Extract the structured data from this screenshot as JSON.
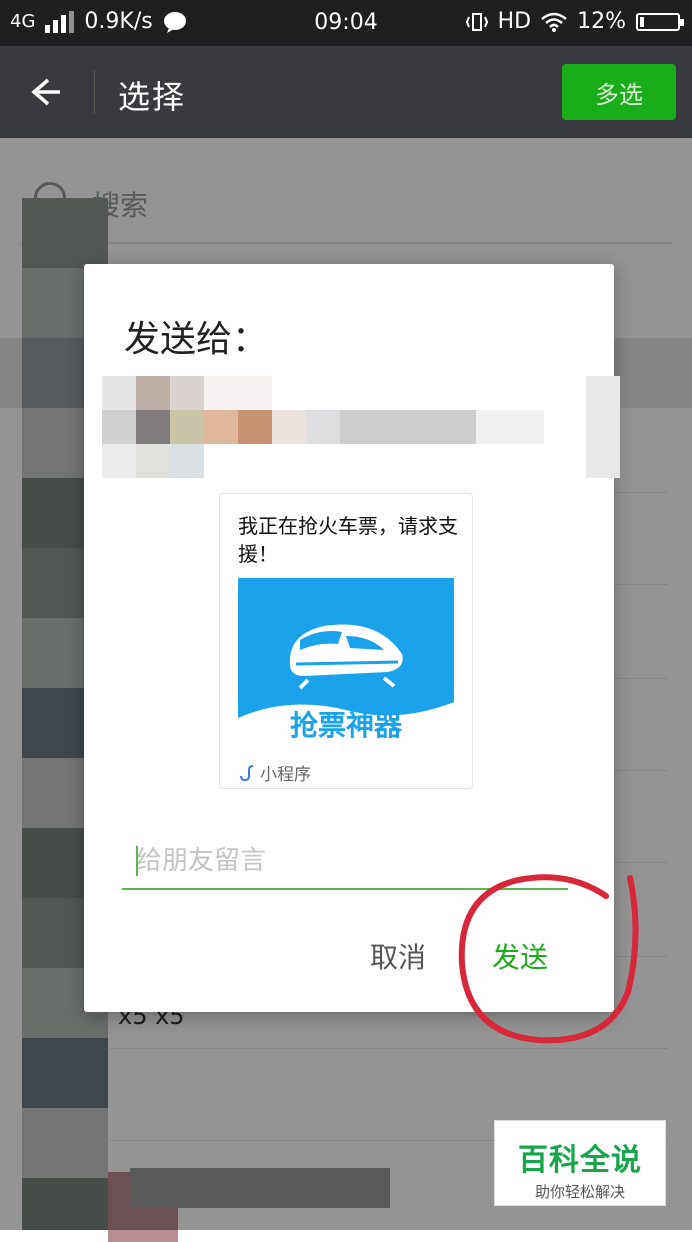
{
  "status_bar": {
    "network": "4G",
    "speed": "0.9K/s",
    "time": "09:04",
    "hd": "HD",
    "battery": "12%",
    "battery_level": 0.12
  },
  "app_bar": {
    "title": "选择",
    "multi_select_label": "多选"
  },
  "search": {
    "placeholder": "搜索"
  },
  "background_list": {
    "partial_text": "x5 x5"
  },
  "dialog": {
    "title": "发送给：",
    "card": {
      "message": "我正在抢火车票，请求支援！",
      "thumbnail_text": "抢票神器",
      "source_label": "小程序"
    },
    "message_input_placeholder": "给朋友留言",
    "cancel_label": "取消",
    "send_label": "发送"
  },
  "watermark": {
    "title": "百科全说",
    "subtitle": "助你轻松解决"
  },
  "colors": {
    "accent_green": "#1aad19",
    "annotation_red": "#d8263a",
    "thumbnail_blue": "#1aa3ea"
  }
}
